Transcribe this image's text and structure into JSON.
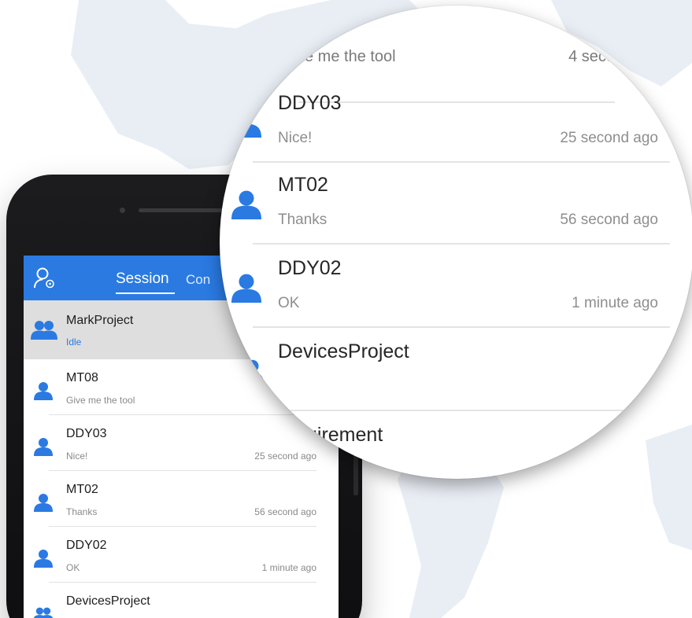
{
  "colors": {
    "accent": "#2a7ae2",
    "selected_row_bg": "#dedede",
    "phone_body": "#151517"
  },
  "header": {
    "profile_icon": "user-settings-icon",
    "tabs": [
      {
        "label": "Session",
        "active": true
      },
      {
        "label": "Con",
        "active": false
      }
    ]
  },
  "sessions": [
    {
      "name": "MarkProject",
      "preview": "Idle",
      "time": "",
      "type": "group",
      "selected": true
    },
    {
      "name": "MT08",
      "preview": "Give me the tool",
      "time": "4 se",
      "type": "user"
    },
    {
      "name": "DDY03",
      "preview": "Nice!",
      "time": "25 second ago",
      "type": "user"
    },
    {
      "name": "MT02",
      "preview": "Thanks",
      "time": "56 second ago",
      "type": "user"
    },
    {
      "name": "DDY02",
      "preview": "OK",
      "time": "1 minute ago",
      "type": "user"
    },
    {
      "name": "DevicesProject",
      "preview": "",
      "time": "",
      "type": "group"
    }
  ],
  "zoom": {
    "rows": [
      {
        "name": "",
        "preview": "e me the tool",
        "time": "4 seco",
        "type": "user"
      },
      {
        "name": "DDY03",
        "preview": "Nice!",
        "time": "25 second ago",
        "type": "user"
      },
      {
        "name": "MT02",
        "preview": "Thanks",
        "time": "56 second ago",
        "type": "user"
      },
      {
        "name": "DDY02",
        "preview": "OK",
        "time": "1 minute ago",
        "type": "user"
      },
      {
        "name": "DevicesProject",
        "preview": "",
        "time": "",
        "type": "group"
      },
      {
        "name": "uirement",
        "preview": "",
        "time": "",
        "type": "none"
      }
    ]
  }
}
